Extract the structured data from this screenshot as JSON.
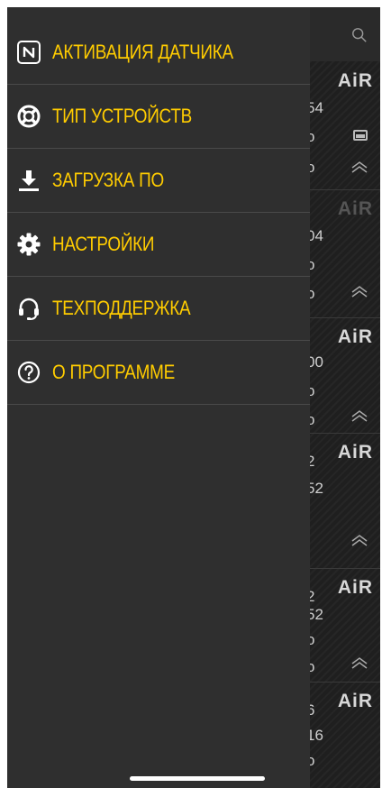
{
  "menu": {
    "items": [
      {
        "label": "АКТИВАЦИЯ ДАТЧИКА",
        "icon": "nfc-icon"
      },
      {
        "label": "ТИП УСТРОЙСТВ",
        "icon": "lifebuoy-icon"
      },
      {
        "label": "ЗАГРУЗКА ПО",
        "icon": "download-icon"
      },
      {
        "label": "НАСТРОЙКИ",
        "icon": "gear-icon"
      },
      {
        "label": "ТЕХПОДДЕРЖКА",
        "icon": "headset-icon"
      },
      {
        "label": "О ПРОГРАММЕ",
        "icon": "help-circle-icon"
      }
    ]
  },
  "background": {
    "search_icon": "search-icon",
    "cards": [
      {
        "brand": "AiR",
        "line1": "54",
        "line2": "o",
        "line3": "o"
      },
      {
        "brand": "AiR",
        "line1": "04",
        "line2": "o",
        "line3": "o"
      },
      {
        "brand": "AiR",
        "line1": "00",
        "line2": "o",
        "line3": "o"
      },
      {
        "brand": "AiR",
        "line1": "2",
        "line2": "52",
        "line3": ""
      },
      {
        "brand": "AiR",
        "line1": "2",
        "line2": "52",
        "line3": "o",
        "line4": "o"
      },
      {
        "brand": "AiR",
        "line1": "6",
        "line2": "16",
        "line3": "o"
      }
    ]
  },
  "colors": {
    "accent": "#ffcc00",
    "drawer": "#2f2f2f",
    "divider": "#4a4a4a"
  }
}
